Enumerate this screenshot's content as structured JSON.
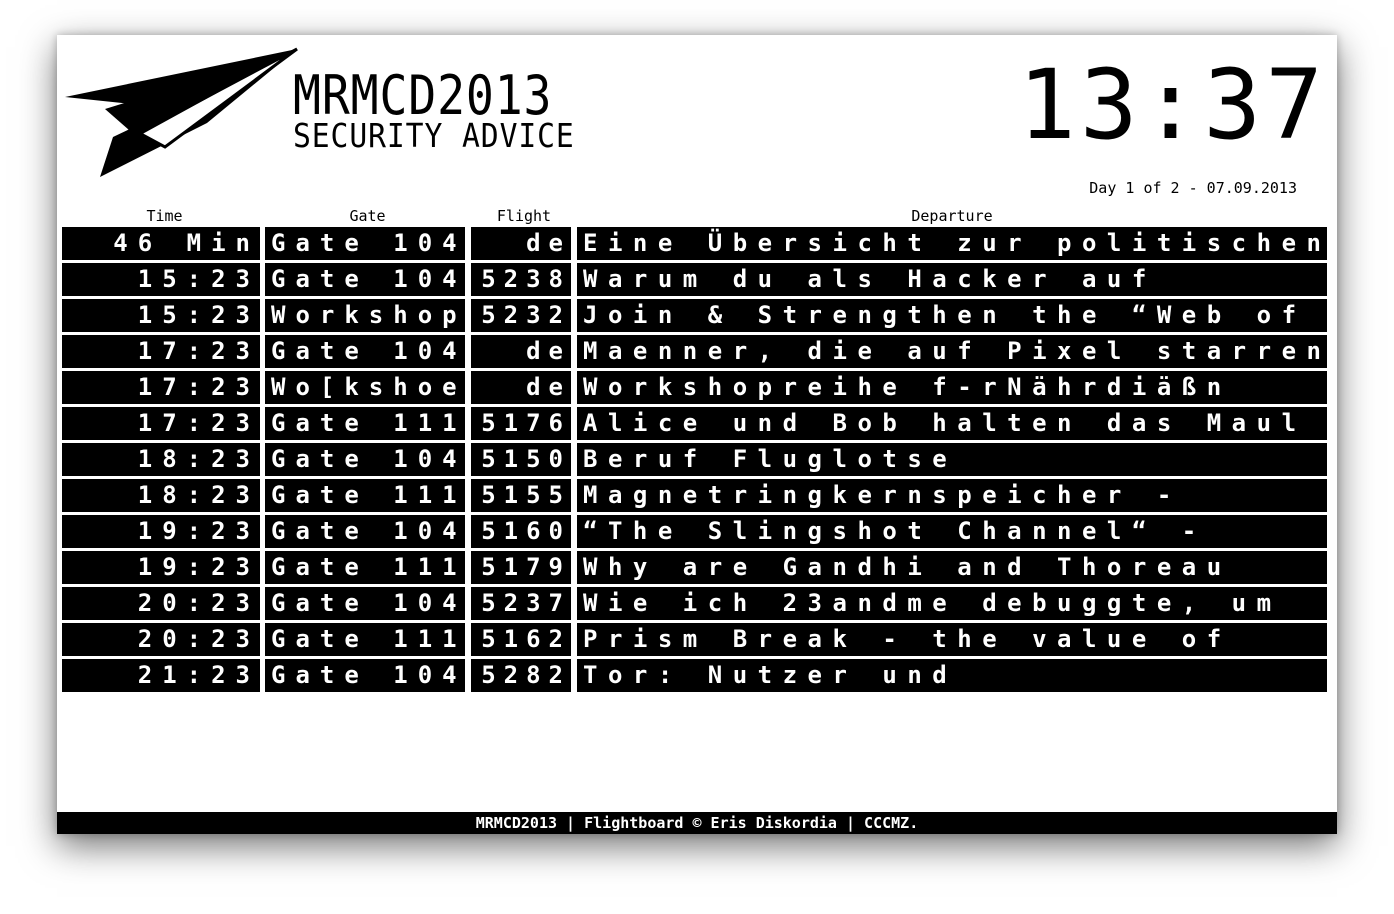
{
  "header": {
    "title": "MRMCD2013",
    "subtitle": "SECURITY ADVICE",
    "clock": "13:37",
    "day_info": "Day 1 of 2 - 07.09.2013"
  },
  "columns": {
    "time": "Time",
    "gate": "Gate",
    "flight": "Flight",
    "departure": "Departure"
  },
  "rows": [
    {
      "time": "46 Min",
      "gate": "Gate 104",
      "flight": "de",
      "departure": "Eine Übersicht zur politischen"
    },
    {
      "time": "15:23",
      "gate": "Gate 104",
      "flight": "5238",
      "departure": "Warum du als Hacker auf"
    },
    {
      "time": "15:23",
      "gate": "Workshop",
      "flight": "5232",
      "departure": "Join & Strengthen the “Web of"
    },
    {
      "time": "17:23",
      "gate": "Gate 104",
      "flight": "de",
      "departure": "Maenner, die auf Pixel starren"
    },
    {
      "time": "17:23",
      "gate": "Wo[kshoe",
      "flight": "de",
      "departure": "Workshopreihe f-rNährdiäßn"
    },
    {
      "time": "17:23",
      "gate": "Gate 111",
      "flight": "5176",
      "departure": "Alice und Bob halten das Maul"
    },
    {
      "time": "18:23",
      "gate": "Gate 104",
      "flight": "5150",
      "departure": "Beruf Fluglotse"
    },
    {
      "time": "18:23",
      "gate": "Gate 111",
      "flight": "5155",
      "departure": "Magnetringkernspeicher -"
    },
    {
      "time": "19:23",
      "gate": "Gate 104",
      "flight": "5160",
      "departure": "“The Slingshot Channel“ -"
    },
    {
      "time": "19:23",
      "gate": "Gate 111",
      "flight": "5179",
      "departure": "Why are Gandhi and Thoreau"
    },
    {
      "time": "20:23",
      "gate": "Gate 104",
      "flight": "5237",
      "departure": "Wie ich 23andme debuggte, um"
    },
    {
      "time": "20:23",
      "gate": "Gate 111",
      "flight": "5162",
      "departure": "Prism Break - the value of"
    },
    {
      "time": "21:23",
      "gate": "Gate 104",
      "flight": "5282",
      "departure": "Tor: Nutzer und"
    }
  ],
  "footer": {
    "text": "MRMCD2013 | Flightboard © Eris Diskordia | CCCMZ."
  },
  "icons": {
    "logo": "paper-plane-icon"
  },
  "colors": {
    "board_background": "#000000",
    "board_text": "#ffffff",
    "page_background": "#ffffff"
  }
}
